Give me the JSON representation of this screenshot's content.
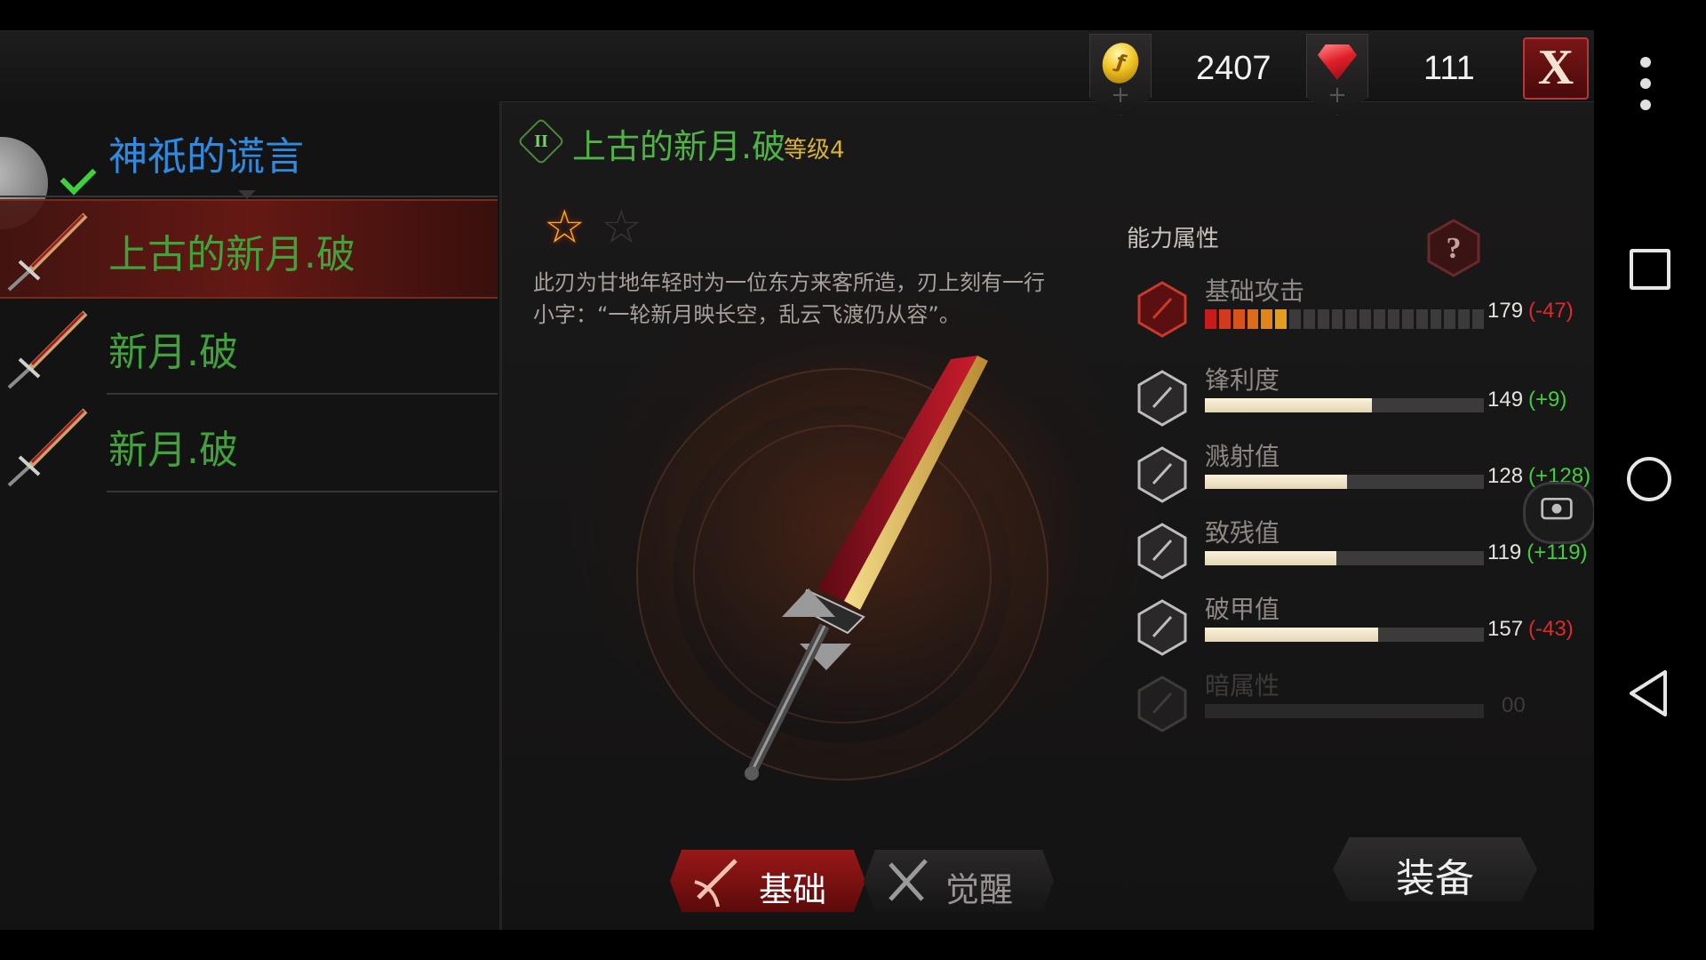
{
  "currency": {
    "gold": {
      "icon": "gold-coin-icon",
      "value": "2407",
      "glyph": "ƒ",
      "plus": "+"
    },
    "ruby": {
      "icon": "ruby-gem-icon",
      "value": "111",
      "plus": "+"
    },
    "close_label": "X"
  },
  "list": {
    "items": [
      {
        "label": "神祇的谎言",
        "color": "#2f8be0",
        "state": "equipped"
      },
      {
        "label": "上古的新月.破",
        "color": "#3fa33a",
        "state": "selected"
      },
      {
        "label": "新月.破",
        "color": "#3fa33a",
        "state": "normal"
      },
      {
        "label": "新月.破",
        "color": "#3fa33a",
        "state": "normal"
      }
    ]
  },
  "weapon": {
    "rank": "II",
    "name": "上古的新月.破",
    "level": "等级4",
    "stars": {
      "filled": 1,
      "total": 2
    },
    "description": "此刃为甘地年轻时为一位东方来客所造，刃上刻有一行小字：“一轮新月映长空，乱云飞渡仍从容”。"
  },
  "tabs": {
    "base_label": "基础",
    "awake_label": "觉醒",
    "active": "基础"
  },
  "stats": {
    "title": "能力属性",
    "help_label": "?",
    "rows": [
      {
        "label": "基础攻击",
        "value": "179",
        "delta": "(-47)",
        "delta_type": "neg",
        "icon": "attack-shield-icon",
        "segmented": true,
        "fill": 0.3
      },
      {
        "label": "锋利度",
        "value": "149",
        "delta": "(+9)",
        "delta_type": "pos",
        "icon": "sharpness-icon",
        "fill": 0.6
      },
      {
        "label": "溅射值",
        "value": "128",
        "delta": "(+128)",
        "delta_type": "pos",
        "icon": "splash-icon",
        "fill": 0.51
      },
      {
        "label": "致残值",
        "value": "119",
        "delta": "(+119)",
        "delta_type": "pos",
        "icon": "cripple-icon",
        "fill": 0.47
      },
      {
        "label": "破甲值",
        "value": "157",
        "delta": "(-43)",
        "delta_type": "neg",
        "icon": "armor-break-icon",
        "fill": 0.62
      },
      {
        "label": "暗属性",
        "value": "00",
        "delta": "",
        "delta_type": "none",
        "icon": "dark-element-icon",
        "fill": 0,
        "disabled": true
      }
    ]
  },
  "equip_label": "装备",
  "colors": {
    "accent_red": "#9a1818",
    "name_green": "#4fb346",
    "list_blue": "#2f8be0",
    "level_gold": "#d9b23a",
    "positive": "#3fcf3f",
    "negative": "#e02a2a"
  }
}
